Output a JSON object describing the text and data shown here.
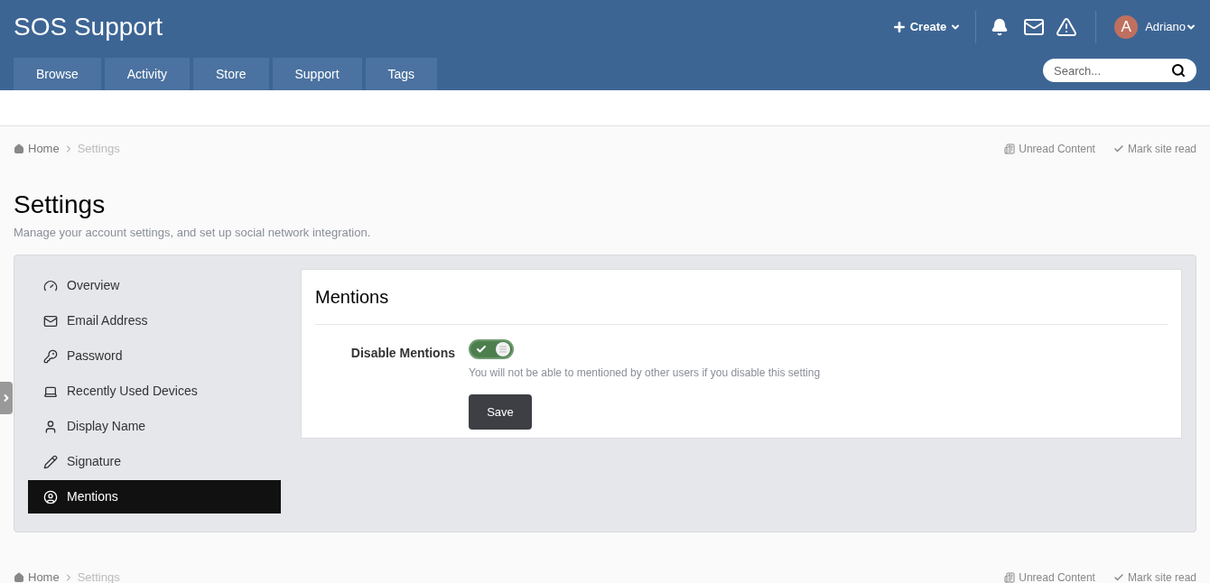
{
  "site_title": "SOS Support",
  "header_actions": {
    "create": "Create",
    "avatar_letter": "A",
    "user": "Adriano"
  },
  "nav_tabs": [
    {
      "label": "Browse",
      "selected": false
    },
    {
      "label": "Activity",
      "selected": false
    },
    {
      "label": "Store",
      "selected": false
    },
    {
      "label": "Support",
      "selected": false
    },
    {
      "label": "Tags",
      "selected": false
    }
  ],
  "search": {
    "placeholder": "Search..."
  },
  "breadcrumb": {
    "items": [
      "Home",
      "Settings"
    ],
    "links": [
      "Unread Content",
      "Mark site read"
    ]
  },
  "page": {
    "title": "Settings",
    "subtitle": "Manage your account settings, and set up social network integration."
  },
  "sidebar": {
    "items": [
      {
        "label": "Overview",
        "selected": false
      },
      {
        "label": "Email Address",
        "selected": false
      },
      {
        "label": "Password",
        "selected": false
      },
      {
        "label": "Recently Used Devices",
        "selected": false
      },
      {
        "label": "Display Name",
        "selected": false
      },
      {
        "label": "Signature",
        "selected": false
      },
      {
        "label": "Mentions",
        "selected": true
      }
    ]
  },
  "card": {
    "title": "Mentions",
    "setting_label": "Disable Mentions",
    "toggle_on": true,
    "hint": "You will not be able to mentioned by other users if you disable this setting",
    "save": "Save"
  },
  "footer_breadcrumb": {
    "items": [
      "Home",
      "Settings"
    ],
    "links": [
      "Unread Content",
      "Mark site read"
    ]
  }
}
